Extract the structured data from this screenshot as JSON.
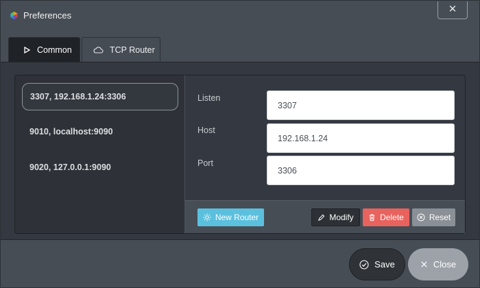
{
  "window": {
    "title": "Preferences",
    "close_glyph": "✕"
  },
  "tabs": [
    {
      "label": "Common",
      "icon": "play-icon",
      "active": true
    },
    {
      "label": "TCP Router",
      "icon": "cloud-icon",
      "active": false
    }
  ],
  "routers": [
    {
      "label": "3307, 192.168.1.24:3306",
      "selected": true
    },
    {
      "label": "9010, localhost:9090",
      "selected": false
    },
    {
      "label": "9020, 127.0.0.1:9090",
      "selected": false
    }
  ],
  "form": {
    "listen_label": "Listen",
    "listen_value": "3307",
    "host_label": "Host",
    "host_value": "192.168.1.24",
    "port_label": "Port",
    "port_value": "3306"
  },
  "actions": {
    "new_router": "New Router",
    "modify": "Modify",
    "delete": "Delete",
    "reset": "Reset"
  },
  "dialog": {
    "save": "Save",
    "close": "Close"
  },
  "colors": {
    "info": "#5bc0de",
    "danger": "#e8625e",
    "neutral": "#8a9096",
    "dark": "#2d3136"
  }
}
